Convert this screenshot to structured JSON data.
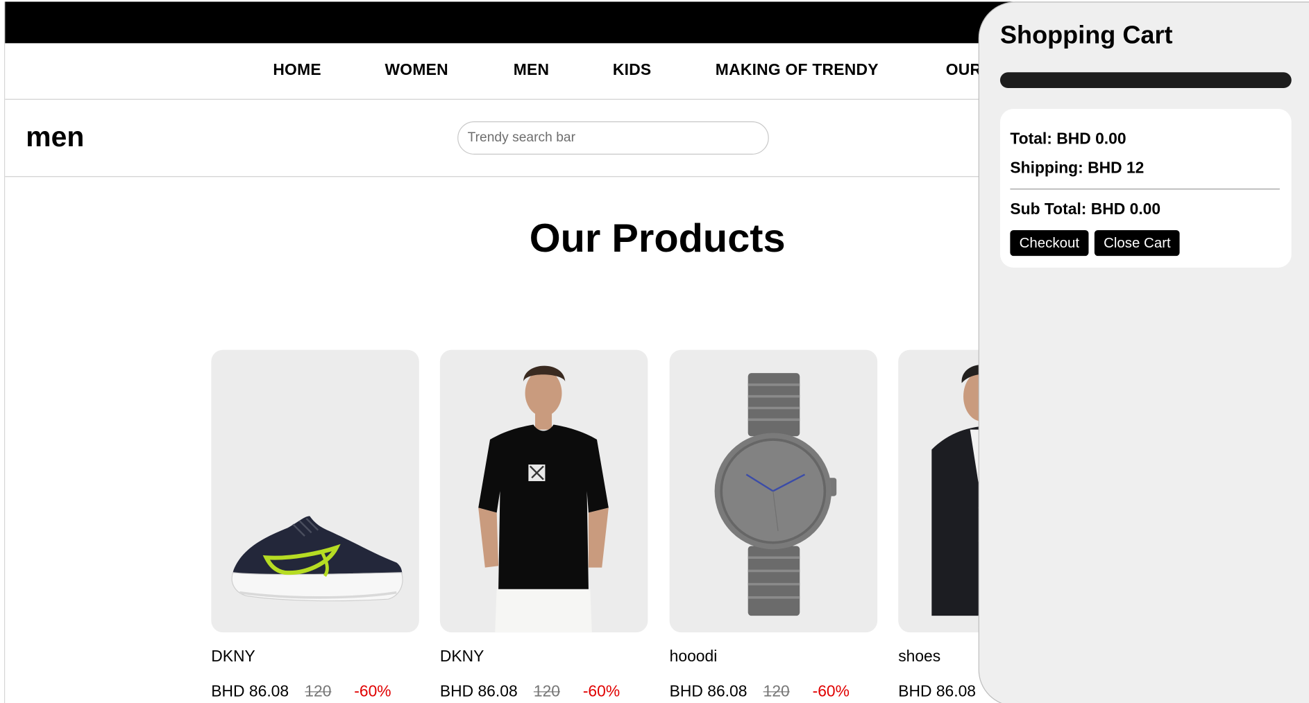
{
  "nav": {
    "items": [
      "HOME",
      "WOMEN",
      "MEN",
      "KIDS",
      "MAKING OF TRENDY",
      "OUR"
    ]
  },
  "header": {
    "title": "men",
    "search_placeholder": "Trendy search bar"
  },
  "main": {
    "section_title": "Our Products",
    "products": [
      {
        "name": "DKNY",
        "price": "BHD 86.08",
        "old_price": "120",
        "discount": "-60%",
        "image_icon": "sneaker-icon"
      },
      {
        "name": "DKNY",
        "price": "BHD 86.08",
        "old_price": "120",
        "discount": "-60%",
        "image_icon": "tshirt-icon"
      },
      {
        "name": "hooodi",
        "price": "BHD 86.08",
        "old_price": "120",
        "discount": "-60%",
        "image_icon": "watch-icon"
      },
      {
        "name": "shoes",
        "price": "BHD 86.08",
        "old_price": "",
        "discount": "",
        "image_icon": "jacket-icon"
      }
    ]
  },
  "cart": {
    "title": "Shopping Cart",
    "total": "Total: BHD 0.00",
    "shipping": "Shipping: BHD 12",
    "subtotal": "Sub Total: BHD 0.00",
    "checkout_label": "Checkout",
    "close_label": "Close Cart"
  },
  "colors": {
    "topbar": "#000000",
    "discount": "#e00000",
    "cart_bg": "#efefef",
    "button_bg": "#000000"
  }
}
